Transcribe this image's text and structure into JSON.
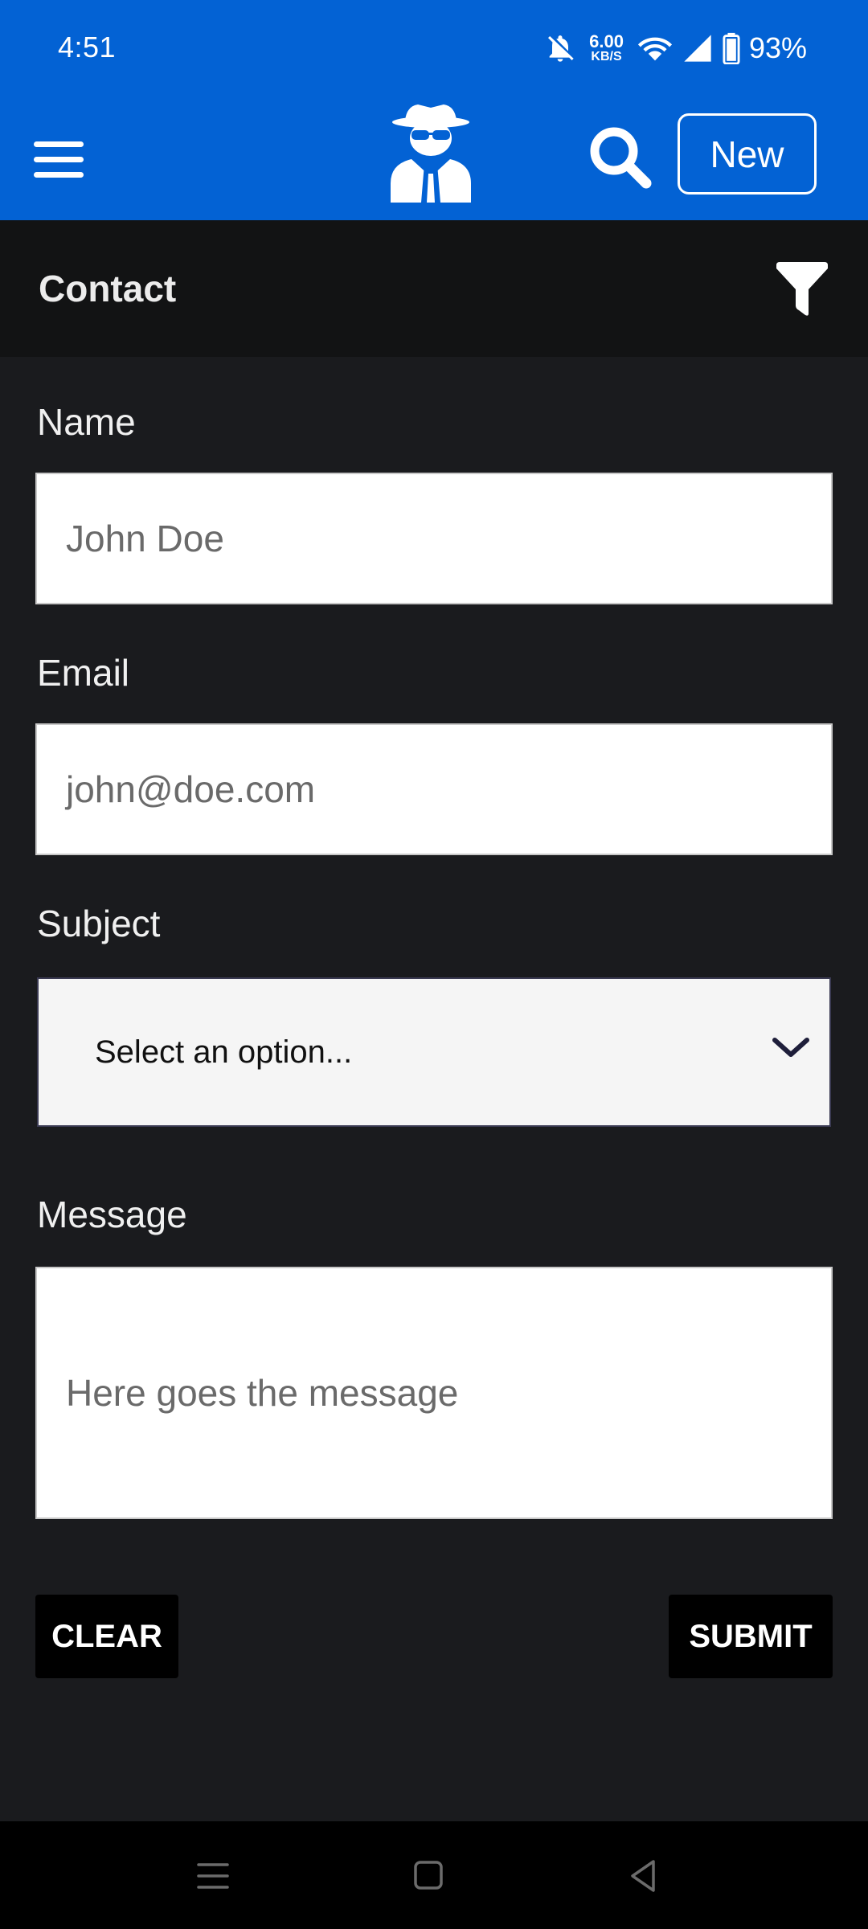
{
  "status_bar": {
    "time": "4:51",
    "net_speed_value": "6.00",
    "net_speed_unit": "KB/S",
    "battery": "93%",
    "icons": [
      "bell-off-icon",
      "wifi-icon",
      "signal-icon",
      "battery-icon"
    ]
  },
  "app_bar": {
    "new_label": "New",
    "accent_color": "#0362d4",
    "icons": [
      "menu-icon",
      "spy-logo-icon",
      "search-icon"
    ]
  },
  "sub_header": {
    "title": "Contact",
    "icons": [
      "filter-icon"
    ]
  },
  "form": {
    "name": {
      "label": "Name",
      "placeholder": "John Doe"
    },
    "email": {
      "label": "Email",
      "placeholder": "john@doe.com"
    },
    "subject": {
      "label": "Subject",
      "selected": "Select an option..."
    },
    "message": {
      "label": "Message",
      "placeholder": "Here goes the message"
    },
    "clear_label": "CLEAR",
    "submit_label": "SUBMIT"
  },
  "nav_bar": {
    "icons": [
      "recents-icon",
      "home-icon",
      "back-icon"
    ]
  }
}
